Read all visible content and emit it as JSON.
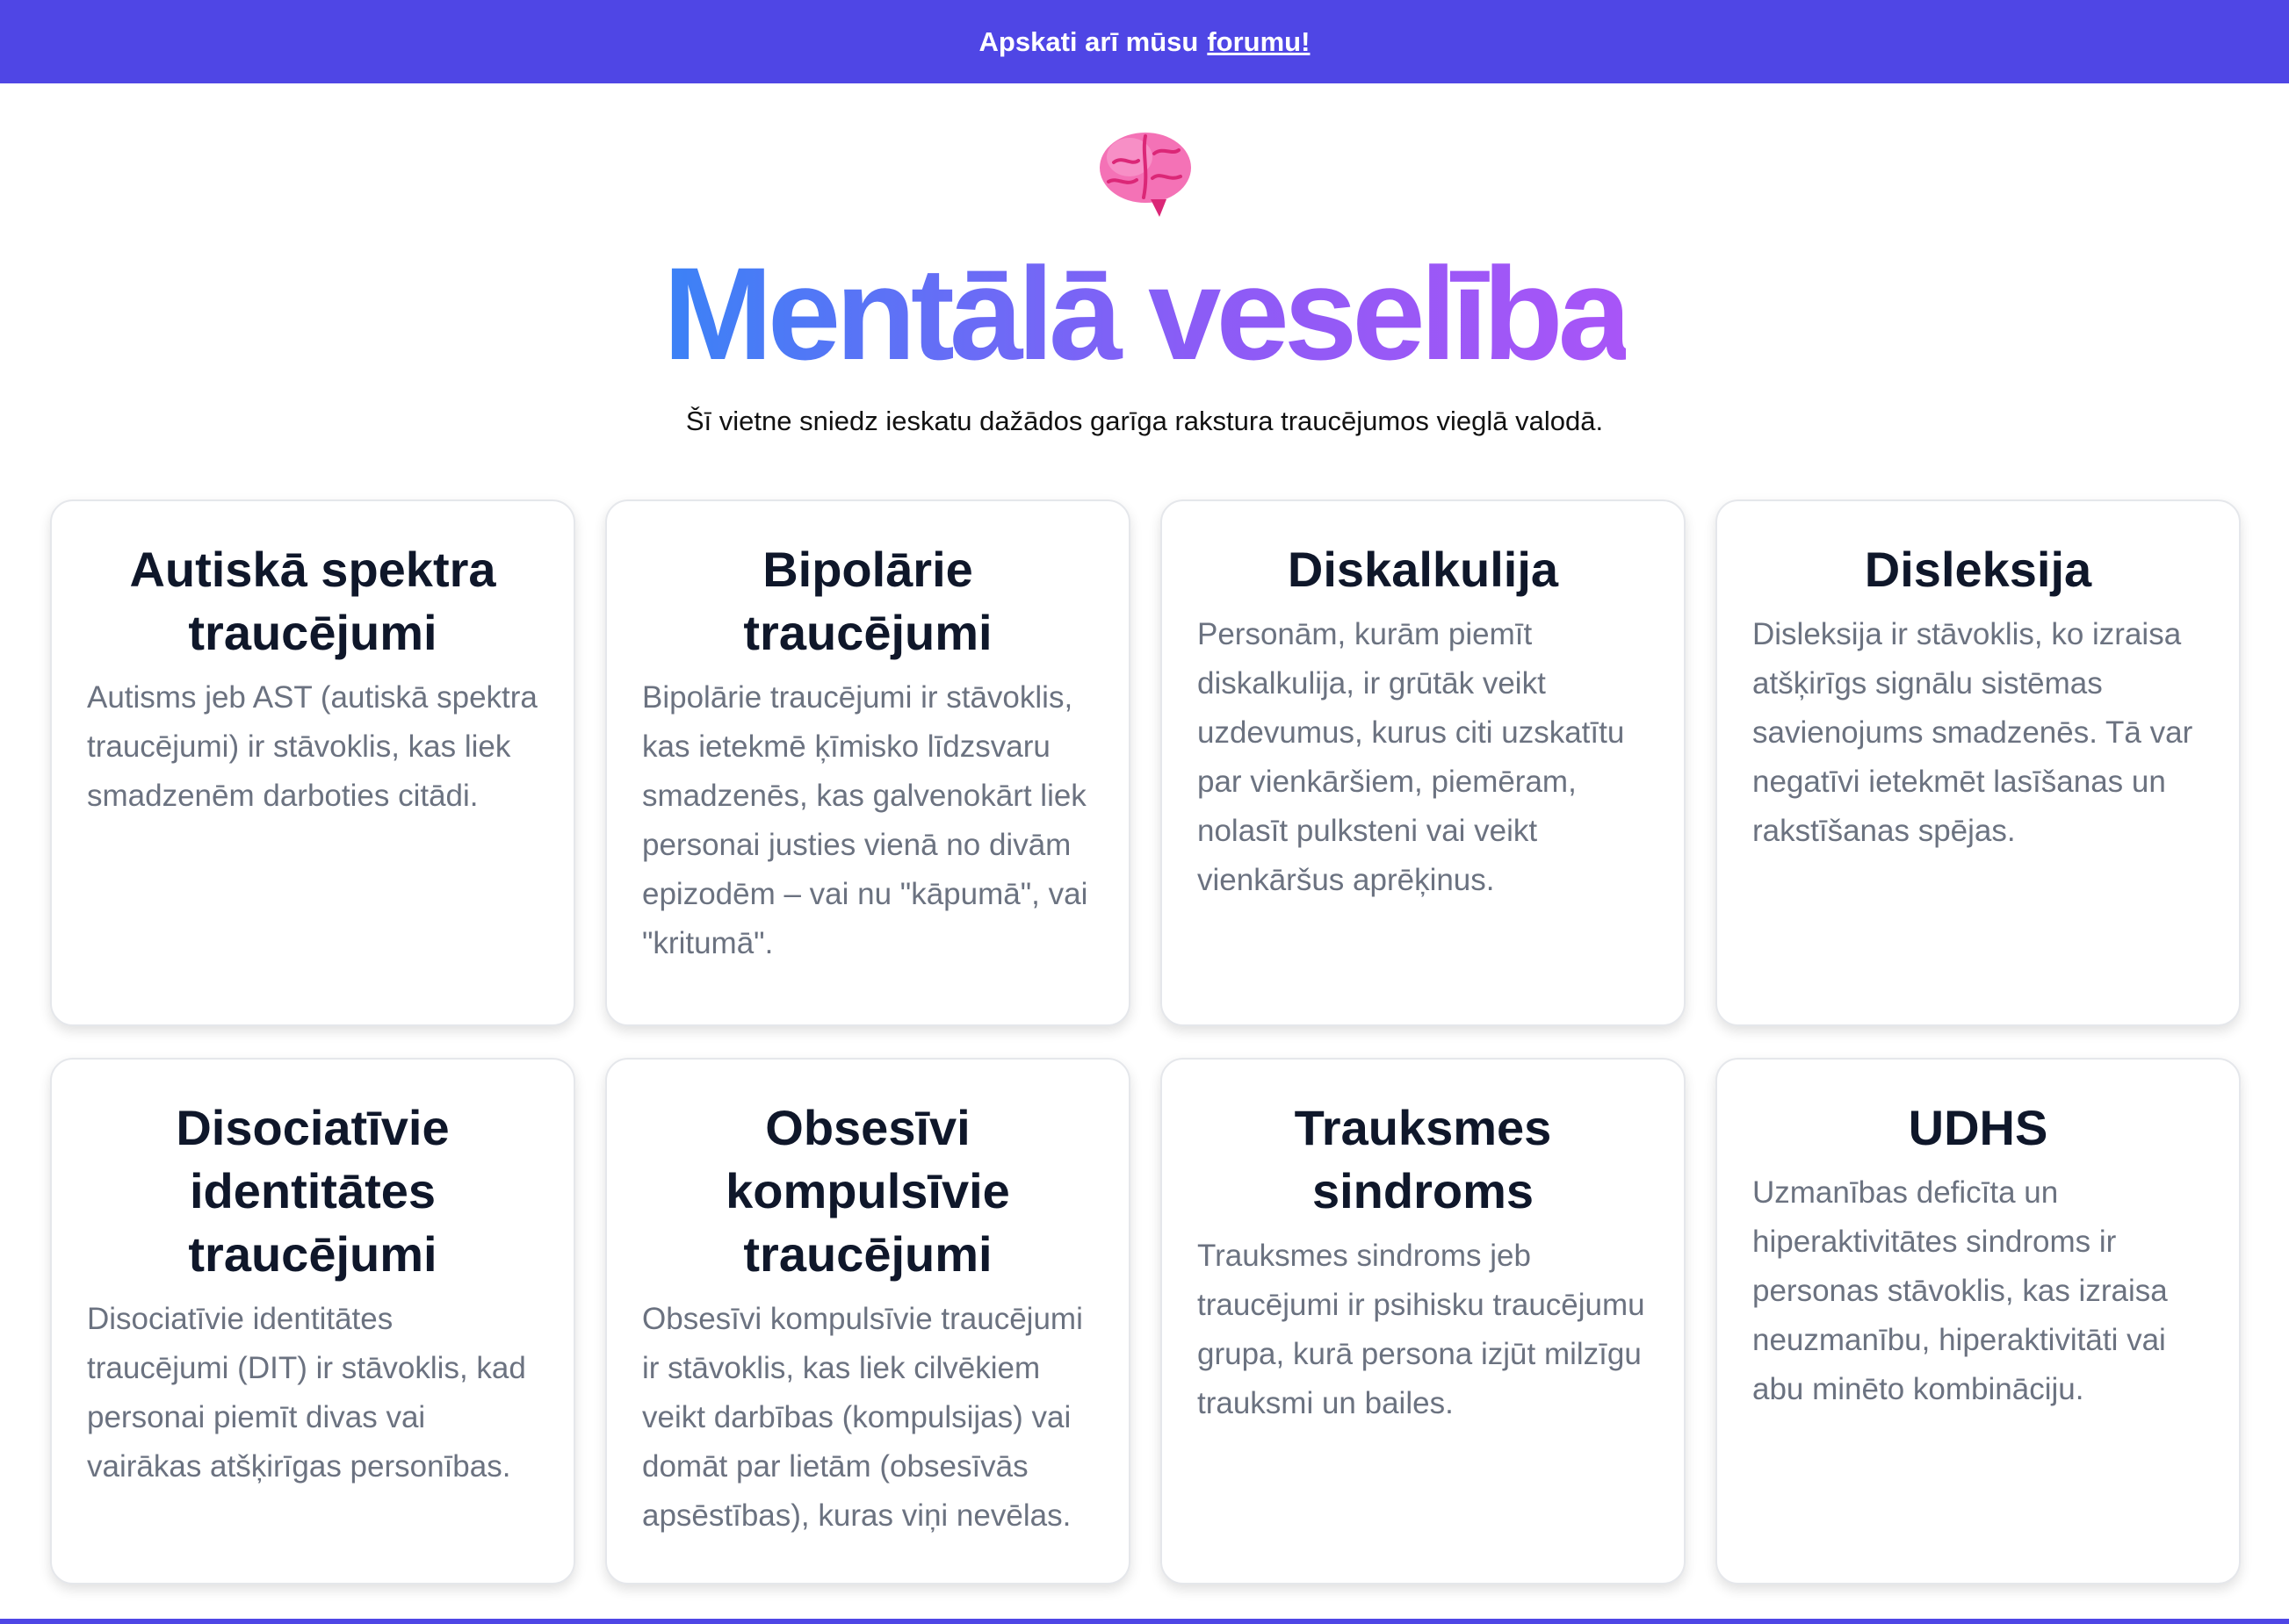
{
  "banner": {
    "text": "Apskati arī mūsu",
    "link": "forumu!",
    "color": "#4f46e5"
  },
  "hero": {
    "icon": "brain-icon",
    "title": "Mentālā veselība",
    "subtitle": "Šī vietne sniedz ieskatu dažādos garīga rakstura traucējumos vieglā valodā."
  },
  "cards": [
    {
      "title": "Autiskā spektra traucējumi",
      "text": "Autisms jeb AST (autiskā spektra traucējumi) ir stāvoklis, kas liek smadzenēm darboties citādi."
    },
    {
      "title": "Bipolārie traucējumi",
      "text": "Bipolārie traucējumi ir stāvoklis, kas ietekmē ķīmisko līdzsvaru smadzenēs, kas galvenokārt liek personai justies vienā no divām epizodēm – vai nu \"kāpumā\", vai \"kritumā\"."
    },
    {
      "title": "Diskalkulija",
      "text": "Personām, kurām piemīt diskalkulija, ir grūtāk veikt uzdevumus, kurus citi uzskatītu par vienkāršiem, piemēram, nolasīt pulksteni vai veikt vienkāršus aprēķinus."
    },
    {
      "title": "Disleksija",
      "text": "Disleksija ir stāvoklis, ko izraisa atšķirīgs signālu sistēmas savienojums smadzenēs. Tā var negatīvi ietekmēt lasīšanas un rakstīšanas spējas."
    },
    {
      "title": "Disociatīvie identitātes traucējumi",
      "text": "Disociatīvie identitātes traucējumi (DIT) ir stāvoklis, kad personai piemīt divas vai vairākas atšķirīgas personības."
    },
    {
      "title": "Obsesīvi kompulsīvie traucējumi",
      "text": "Obsesīvi kompulsīvie traucējumi ir stāvoklis, kas liek cilvēkiem veikt darbības (kompulsijas) vai domāt par lietām (obsesīvās apsēstības), kuras viņi nevēlas."
    },
    {
      "title": "Trauksmes sindroms",
      "text": "Trauksmes sindroms jeb traucējumi ir psihisku traucējumu grupa, kurā persona izjūt milzīgu trauksmi un bailes."
    },
    {
      "title": "UDHS",
      "text": "Uzmanības deficīta un hiperaktivitātes sindroms ir personas stāvoklis, kas izraisa neuzmanību, hiperaktivitāti vai abu minēto kombināciju."
    }
  ]
}
